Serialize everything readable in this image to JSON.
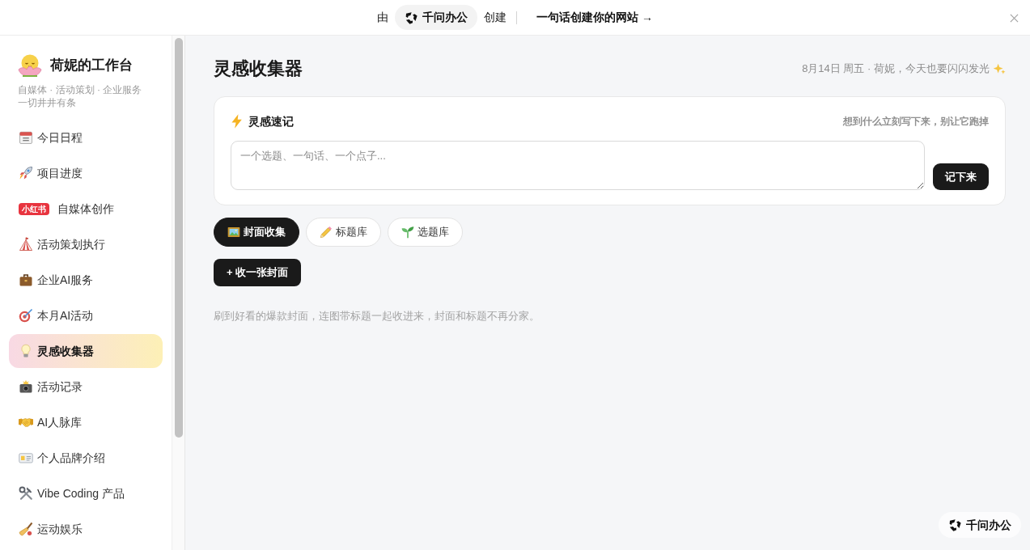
{
  "top_banner": {
    "prefix": "由",
    "brand": "千问办公",
    "suffix": "创建",
    "link": "一句话创建你的网站 →"
  },
  "sidebar": {
    "title": "荷妮的工作台",
    "subtitle": [
      "自媒体 · 活动策划 · 企业服务",
      "一切井井有条"
    ],
    "items": [
      {
        "kind": "emoji",
        "label": "今日日程",
        "selected": false
      },
      {
        "kind": "emoji",
        "label": "项目进度",
        "selected": false
      },
      {
        "kind": "badge",
        "badge": "小红书",
        "label": "自媒体创作",
        "selected": false
      },
      {
        "kind": "emoji",
        "label": "活动策划执行",
        "selected": false
      },
      {
        "kind": "emoji",
        "label": "企业AI服务",
        "selected": false
      },
      {
        "kind": "emoji",
        "label": "本月AI活动",
        "selected": false
      },
      {
        "kind": "emoji",
        "label": "灵感收集器",
        "selected": true
      },
      {
        "kind": "emoji",
        "label": "活动记录",
        "selected": false
      },
      {
        "kind": "emoji",
        "label": "AI人脉库",
        "selected": false
      },
      {
        "kind": "emoji",
        "label": "个人品牌介绍",
        "selected": false
      },
      {
        "kind": "emoji",
        "label": "Vibe Coding 产品",
        "selected": false
      },
      {
        "kind": "emoji",
        "label": "运动娱乐",
        "selected": false
      }
    ]
  },
  "page": {
    "title": "灵感收集器",
    "greeting": "8月14日 周五 · 荷妮，今天也要闪闪发光"
  },
  "quick_note": {
    "title": "灵感速记",
    "hint": "想到什么立刻写下来，别让它跑掉",
    "placeholder": "一个选题、一句话、一个点子...",
    "button": "记下来"
  },
  "tabs": [
    {
      "label": "封面收集",
      "selected": true
    },
    {
      "label": "标题库",
      "selected": false
    },
    {
      "label": "选题库",
      "selected": false
    }
  ],
  "add_button": "+ 收一张封面",
  "description": "刷到好看的爆款封面，连图带标题一起收进来，封面和标题不再分家。",
  "footer_badge": "千问办公"
}
